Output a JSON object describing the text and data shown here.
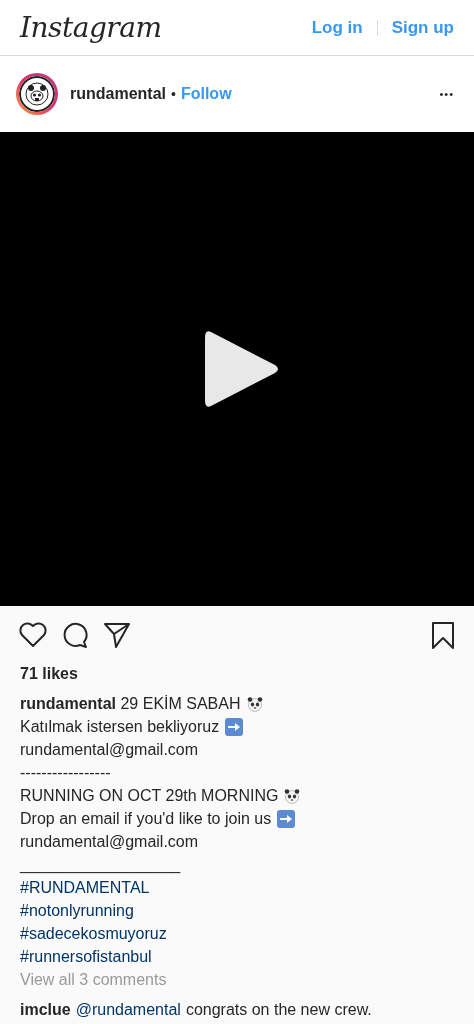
{
  "top_bar": {
    "logo": "Instagram",
    "login": "Log in",
    "signup": "Sign up"
  },
  "post_header": {
    "username": "rundamental",
    "separator": "•",
    "follow": "Follow",
    "more": "•••"
  },
  "media": {
    "kind": "video"
  },
  "likes": "71 likes",
  "caption": [
    {
      "kind": "pandaline",
      "text": "**rundamental** 29 EKİM SABAH"
    },
    {
      "kind": "arrowline",
      "text": "Katılmak istersen bekliyoruz"
    },
    {
      "kind": "text",
      "text": "rundamental@gmail.com"
    },
    {
      "kind": "text",
      "text": "-----------------"
    },
    {
      "kind": "pandaline",
      "text": "RUNNING ON OCT 29th MORNING"
    },
    {
      "kind": "arrowline",
      "text": "Drop an email if you'd like to join us"
    },
    {
      "kind": "text",
      "text": "rundamental@gmail.com"
    },
    {
      "kind": "gap"
    },
    {
      "kind": "text",
      "text": "__________________"
    },
    {
      "kind": "hashtag",
      "text": "#RUNDAMENTAL"
    },
    {
      "kind": "hashtag",
      "text": "#notonlyrunning"
    },
    {
      "kind": "hashtag",
      "text": "#sadecekosmuyoruz"
    },
    {
      "kind": "hashtag",
      "text": "#runnersofistanbul"
    }
  ],
  "view_comments": "View all 3 comments",
  "comments": [
    {
      "user": "imclue",
      "mention": "@rundamental",
      "text": "congrats on the new crew."
    }
  ]
}
